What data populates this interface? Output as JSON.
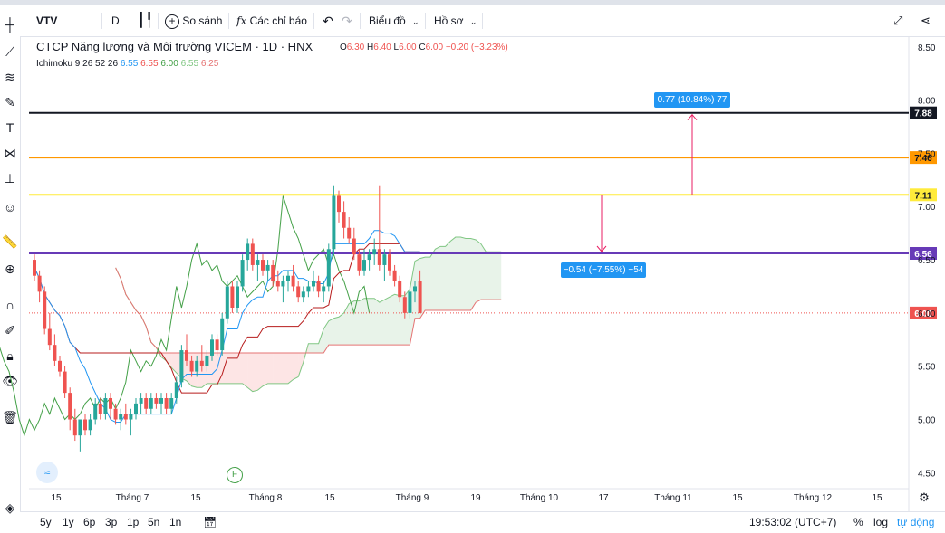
{
  "toolbar": {
    "symbol": "VTV",
    "interval": "D",
    "compare_label": "So sánh",
    "indicators_label": "Các chỉ báo",
    "chart_type_label": "Biểu đồ",
    "profile_label": "Hồ sơ"
  },
  "legend": {
    "title": "CTCP Năng lượng và Môi trường VICEM · 1D · HNX",
    "o_label": "O",
    "o_value": "6.30",
    "h_label": "H",
    "h_value": "6.40",
    "l_label": "L",
    "l_value": "6.00",
    "c_label": "C",
    "c_value": "6.00",
    "change": "−0.20 (−3.23%)",
    "indicator_name": "Ichimoku 9 26 52 26",
    "ind_values": [
      "6.55",
      "6.55",
      "6.00",
      "6.55",
      "6.25"
    ],
    "ind_colors": [
      "#2196f3",
      "#ef5350",
      "#43a047",
      "#81c784",
      "#e57373"
    ]
  },
  "bottom": {
    "ranges": [
      "5y",
      "1y",
      "6p",
      "3p",
      "1p",
      "5n",
      "1n"
    ],
    "time": "19:53:02 (UTC+7)",
    "percent": "%",
    "log": "log",
    "auto": "tự động"
  },
  "measures": {
    "up_label": "0.77 (10.84%) 77",
    "down_label": "−0.54 (−7.55%) −54"
  },
  "event_marker": "F",
  "chart_data": {
    "type": "candlestick",
    "title": "CTCP Năng lượng và Môi trường VICEM · 1D · HNX",
    "price_axis_ticks": [
      4.5,
      5.0,
      5.5,
      6.0,
      6.5,
      7.0,
      7.5,
      8.0,
      8.5
    ],
    "x_axis_labels": [
      "15",
      "Tháng 7",
      "15",
      "Tháng 8",
      "15",
      "Tháng 9",
      "19",
      "Tháng 10",
      "17",
      "Tháng 11",
      "15",
      "Tháng 12",
      "15"
    ],
    "ylim": [
      4.35,
      8.6
    ],
    "horizontal_lines": [
      {
        "value": 7.88,
        "label": "7.88",
        "color": "#131722"
      },
      {
        "value": 7.46,
        "label": "7.46",
        "color": "#ff9800"
      },
      {
        "value": 7.11,
        "label": "7.11",
        "color": "#ffeb3b"
      },
      {
        "value": 6.56,
        "label": "6.56",
        "color": "#673ab7"
      },
      {
        "value": 6.0,
        "label": "6.00",
        "color": "#ef5350"
      }
    ],
    "candles": [
      [
        6.5,
        6.55,
        6.3,
        6.35
      ],
      [
        6.35,
        6.4,
        6.1,
        6.2
      ],
      [
        6.2,
        6.25,
        5.8,
        5.85
      ],
      [
        5.85,
        6.0,
        5.65,
        5.7
      ],
      [
        5.7,
        5.8,
        5.5,
        5.55
      ],
      [
        5.55,
        5.6,
        5.4,
        5.45
      ],
      [
        5.45,
        5.5,
        5.2,
        5.25
      ],
      [
        5.25,
        5.3,
        4.9,
        5.0
      ],
      [
        5.0,
        5.1,
        4.8,
        4.85
      ],
      [
        4.85,
        5.0,
        4.7,
        5.0
      ],
      [
        5.0,
        5.05,
        4.85,
        4.9
      ],
      [
        4.9,
        5.05,
        4.85,
        5.0
      ],
      [
        5.0,
        5.2,
        4.95,
        5.15
      ],
      [
        5.15,
        5.2,
        5.0,
        5.05
      ],
      [
        5.05,
        5.25,
        5.0,
        5.2
      ],
      [
        5.2,
        5.25,
        5.0,
        5.1
      ],
      [
        5.1,
        5.15,
        4.95,
        5.0
      ],
      [
        5.0,
        5.1,
        4.9,
        5.05
      ],
      [
        5.05,
        5.15,
        4.95,
        5.0
      ],
      [
        5.0,
        5.1,
        4.85,
        5.05
      ],
      [
        5.05,
        5.2,
        5.0,
        5.15
      ],
      [
        5.15,
        5.25,
        5.05,
        5.2
      ],
      [
        5.2,
        5.25,
        5.05,
        5.1
      ],
      [
        5.1,
        5.25,
        5.05,
        5.2
      ],
      [
        5.2,
        5.25,
        5.1,
        5.15
      ],
      [
        5.15,
        5.25,
        5.05,
        5.2
      ],
      [
        5.2,
        5.25,
        5.05,
        5.1
      ],
      [
        5.1,
        5.25,
        5.05,
        5.2
      ],
      [
        5.2,
        5.4,
        5.15,
        5.35
      ],
      [
        5.35,
        5.7,
        5.3,
        5.65
      ],
      [
        5.65,
        5.8,
        5.5,
        5.55
      ],
      [
        5.55,
        5.6,
        5.4,
        5.45
      ],
      [
        5.45,
        5.6,
        5.4,
        5.55
      ],
      [
        5.55,
        5.7,
        5.45,
        5.5
      ],
      [
        5.5,
        5.65,
        5.45,
        5.6
      ],
      [
        5.6,
        5.8,
        5.55,
        5.75
      ],
      [
        5.75,
        5.8,
        5.6,
        5.65
      ],
      [
        5.65,
        6.0,
        5.6,
        5.95
      ],
      [
        5.95,
        6.3,
        5.9,
        6.25
      ],
      [
        6.25,
        6.3,
        6.0,
        6.05
      ],
      [
        6.05,
        6.3,
        6.0,
        6.25
      ],
      [
        6.25,
        6.55,
        6.2,
        6.5
      ],
      [
        6.5,
        6.7,
        6.4,
        6.65
      ],
      [
        6.65,
        6.7,
        6.4,
        6.45
      ],
      [
        6.45,
        6.55,
        6.3,
        6.5
      ],
      [
        6.5,
        6.55,
        6.35,
        6.4
      ],
      [
        6.4,
        6.5,
        6.3,
        6.45
      ],
      [
        6.45,
        6.5,
        6.25,
        6.3
      ],
      [
        6.3,
        6.4,
        6.2,
        6.25
      ],
      [
        6.25,
        6.35,
        6.1,
        6.3
      ],
      [
        6.3,
        6.4,
        6.2,
        6.35
      ],
      [
        6.35,
        6.45,
        6.2,
        6.25
      ],
      [
        6.25,
        6.3,
        6.1,
        6.15
      ],
      [
        6.15,
        6.25,
        6.1,
        6.2
      ],
      [
        6.2,
        6.3,
        6.15,
        6.25
      ],
      [
        6.25,
        6.4,
        6.2,
        6.3
      ],
      [
        6.3,
        6.35,
        6.15,
        6.2
      ],
      [
        6.2,
        6.3,
        6.1,
        6.25
      ],
      [
        6.25,
        6.65,
        6.2,
        6.6
      ],
      [
        6.6,
        7.2,
        6.55,
        7.1
      ],
      [
        7.1,
        7.15,
        6.85,
        6.95
      ],
      [
        6.95,
        7.05,
        6.7,
        6.8
      ],
      [
        6.8,
        6.9,
        6.65,
        6.7
      ],
      [
        6.7,
        6.8,
        6.5,
        6.55
      ],
      [
        6.55,
        6.6,
        6.35,
        6.4
      ],
      [
        6.4,
        6.6,
        6.35,
        6.5
      ],
      [
        6.5,
        6.6,
        6.4,
        6.55
      ],
      [
        6.55,
        6.7,
        6.45,
        6.6
      ],
      [
        6.6,
        7.2,
        6.4,
        6.45
      ],
      [
        6.45,
        6.6,
        6.3,
        6.55
      ],
      [
        6.55,
        6.6,
        6.35,
        6.4
      ],
      [
        6.4,
        6.45,
        6.25,
        6.3
      ],
      [
        6.3,
        6.35,
        6.1,
        6.15
      ],
      [
        6.15,
        6.2,
        5.95,
        6.0
      ],
      [
        6.0,
        6.25,
        5.95,
        6.2
      ],
      [
        6.2,
        6.3,
        6.1,
        6.25
      ],
      [
        6.3,
        6.4,
        6.0,
        6.0
      ]
    ]
  }
}
